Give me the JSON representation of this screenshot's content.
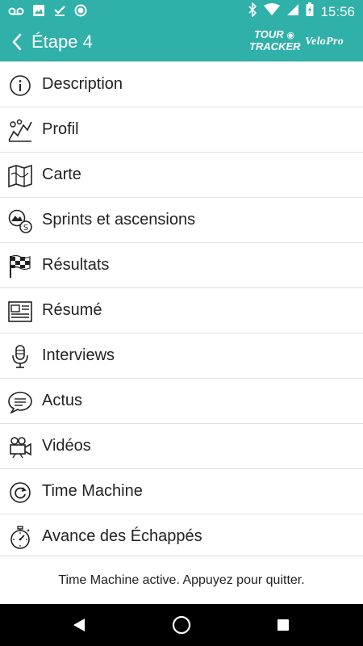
{
  "status_bar": {
    "time": "15:56",
    "left_icons": [
      "voicemail-icon",
      "image-icon",
      "check-icon",
      "record-icon"
    ],
    "right_icons": [
      "bluetooth-icon",
      "wifi-icon",
      "signal-icon",
      "battery-charging-icon"
    ]
  },
  "app_bar": {
    "title": "Étape 4",
    "logo_tour_tracker_line1": "TOUR",
    "logo_tour_tracker_line2": "TRACKER",
    "logo_velopro": "VeloPro"
  },
  "menu": {
    "items": [
      {
        "label": "Description",
        "icon": "info-icon"
      },
      {
        "label": "Profil",
        "icon": "profile-mountain-icon"
      },
      {
        "label": "Carte",
        "icon": "map-icon"
      },
      {
        "label": "Sprints et ascensions",
        "icon": "sprints-climbs-icon"
      },
      {
        "label": "Résultats",
        "icon": "checkered-flag-icon"
      },
      {
        "label": "Résumé",
        "icon": "newspaper-icon"
      },
      {
        "label": "Interviews",
        "icon": "microphone-icon"
      },
      {
        "label": "Actus",
        "icon": "speech-bubble-icon"
      },
      {
        "label": "Vidéos",
        "icon": "video-camera-icon"
      },
      {
        "label": "Time Machine",
        "icon": "refresh-icon"
      },
      {
        "label": "Avance des Échappés",
        "icon": "stopwatch-icon"
      }
    ]
  },
  "footer": {
    "text": "Time Machine active. Appuyez pour quitter."
  },
  "colors": {
    "primary": "#2fb0a8",
    "text": "#222222",
    "divider": "#e2e2e2"
  }
}
